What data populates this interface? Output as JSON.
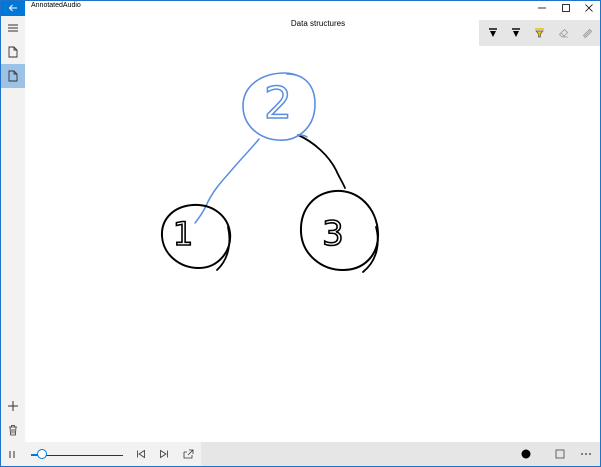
{
  "app": {
    "title": "AnnotatedAudio"
  },
  "page": {
    "title": "Data structures"
  },
  "colors": {
    "accent": "#0078d7",
    "ink_blue": "#5b8ee0",
    "ink_black": "#000000",
    "highlighter": "#f2c400"
  },
  "icons": {
    "back": "back-arrow-icon",
    "minimize": "minimize-icon",
    "maximize": "maximize-icon",
    "close": "close-icon",
    "menu": "hamburger-icon",
    "page1": "document-icon",
    "page2": "document-icon",
    "add": "plus-icon",
    "delete": "trash-icon"
  },
  "ink_tools": [
    "ballpoint-pen-icon",
    "pencil-icon",
    "highlighter-icon",
    "eraser-icon",
    "ruler-icon"
  ],
  "tree": {
    "nodes": [
      {
        "label": "2",
        "ink": "blue"
      },
      {
        "label": "1",
        "ink": "black"
      },
      {
        "label": "3",
        "ink": "black"
      }
    ]
  },
  "playback": {
    "progress": 0.12
  }
}
